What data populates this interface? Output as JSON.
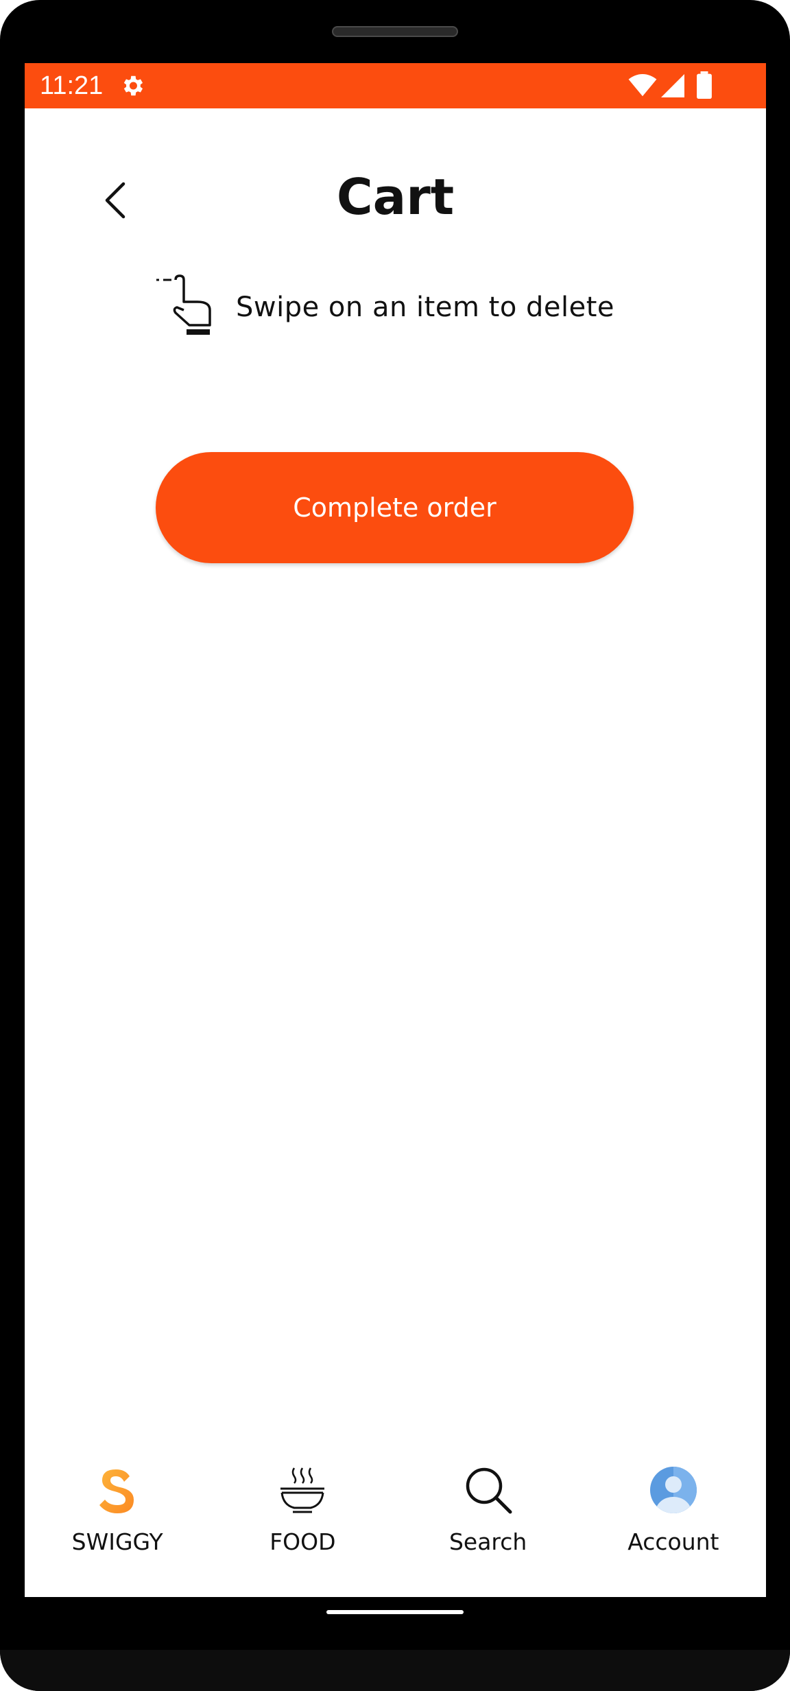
{
  "status_bar": {
    "time": "11:21",
    "icons": [
      "gear-icon",
      "wifi-icon",
      "signal-icon",
      "battery-icon"
    ],
    "background_color": "#FC4D0F"
  },
  "header": {
    "title": "Cart",
    "back_icon": "chevron-left-icon"
  },
  "hint": {
    "icon": "swipe-hand-icon",
    "text": "Swipe on an item to delete"
  },
  "actions": {
    "complete_order_label": "Complete order",
    "accent_color": "#FC4D0F"
  },
  "bottom_nav": {
    "items": [
      {
        "label": "SWIGGY",
        "icon": "swiggy-logo-icon"
      },
      {
        "label": "FOOD",
        "icon": "food-bowl-icon"
      },
      {
        "label": "Search",
        "icon": "search-icon"
      },
      {
        "label": "Account",
        "icon": "account-icon"
      }
    ]
  }
}
